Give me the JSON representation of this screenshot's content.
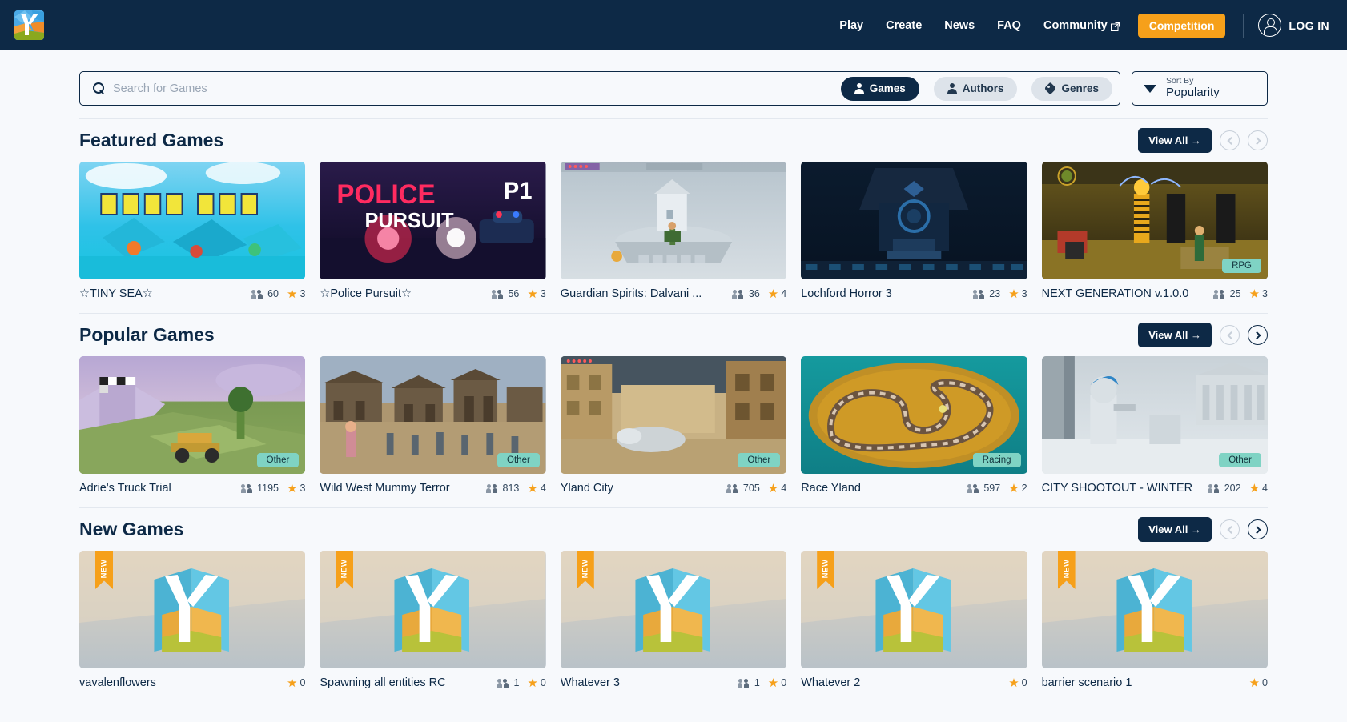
{
  "brand": {
    "logo_alt": "ylands-logo"
  },
  "nav": {
    "links": [
      {
        "label": "Play",
        "external": false
      },
      {
        "label": "Create",
        "external": false
      },
      {
        "label": "News",
        "external": false
      },
      {
        "label": "FAQ",
        "external": false
      },
      {
        "label": "Community",
        "external": true
      }
    ],
    "competition_label": "Competition",
    "login_label": "LOG IN"
  },
  "search": {
    "placeholder": "Search for Games",
    "value": "",
    "filters": [
      {
        "label": "Games",
        "icon": "person-icon",
        "active": true
      },
      {
        "label": "Authors",
        "icon": "person-icon",
        "active": false
      },
      {
        "label": "Genres",
        "icon": "tag-icon",
        "active": false
      }
    ],
    "sort": {
      "label": "Sort By",
      "value": "Popularity"
    }
  },
  "sections": [
    {
      "title": "Featured Games",
      "view_all": "View All",
      "prev_enabled": false,
      "next_enabled": false,
      "games": [
        {
          "name": "☆TINY SEA☆",
          "players": "60",
          "rating": "3",
          "badge": "",
          "new": false,
          "art": "tinysea"
        },
        {
          "name": "☆Police Pursuit☆",
          "players": "56",
          "rating": "3",
          "badge": "",
          "new": false,
          "art": "police"
        },
        {
          "name": "Guardian Spirits: Dalvani ...",
          "players": "36",
          "rating": "4",
          "badge": "",
          "new": false,
          "art": "guardian"
        },
        {
          "name": "Lochford Horror 3",
          "players": "23",
          "rating": "3",
          "badge": "",
          "new": false,
          "art": "lochford"
        },
        {
          "name": "NEXT GENERATION v.1.0.0",
          "players": "25",
          "rating": "3",
          "badge": "RPG",
          "new": false,
          "art": "nextgen"
        }
      ]
    },
    {
      "title": "Popular Games",
      "view_all": "View All",
      "prev_enabled": false,
      "next_enabled": true,
      "games": [
        {
          "name": "Adrie's Truck Trial",
          "players": "1195",
          "rating": "3",
          "badge": "Other",
          "new": false,
          "art": "truck"
        },
        {
          "name": "Wild West Mummy Terror",
          "players": "813",
          "rating": "4",
          "badge": "Other",
          "new": false,
          "art": "wildwest"
        },
        {
          "name": "Yland City",
          "players": "705",
          "rating": "4",
          "badge": "Other",
          "new": false,
          "art": "ylandcity"
        },
        {
          "name": "Race Yland",
          "players": "597",
          "rating": "2",
          "badge": "Racing",
          "new": false,
          "art": "race"
        },
        {
          "name": "CITY SHOOTOUT - WINTER",
          "players": "202",
          "rating": "4",
          "badge": "Other",
          "new": false,
          "art": "cityshoot"
        }
      ]
    },
    {
      "title": "New Games",
      "view_all": "View All",
      "prev_enabled": false,
      "next_enabled": true,
      "games": [
        {
          "name": "vavalenflowers",
          "players": "",
          "rating": "0",
          "badge": "",
          "new": true,
          "art": "placeholder"
        },
        {
          "name": "Spawning all entities RC",
          "players": "1",
          "rating": "0",
          "badge": "",
          "new": true,
          "art": "placeholder-wide"
        },
        {
          "name": "Whatever 3",
          "players": "1",
          "rating": "0",
          "badge": "",
          "new": true,
          "art": "placeholder"
        },
        {
          "name": "Whatever 2",
          "players": "",
          "rating": "0",
          "badge": "",
          "new": true,
          "art": "placeholder"
        },
        {
          "name": "barrier scenario 1",
          "players": "",
          "rating": "0",
          "badge": "",
          "new": true,
          "art": "placeholder"
        }
      ]
    }
  ],
  "colors": {
    "navy": "#0d2946",
    "orange": "#f6a01a",
    "mint": "#7fd3c4",
    "page_bg": "#f7f9fc"
  }
}
